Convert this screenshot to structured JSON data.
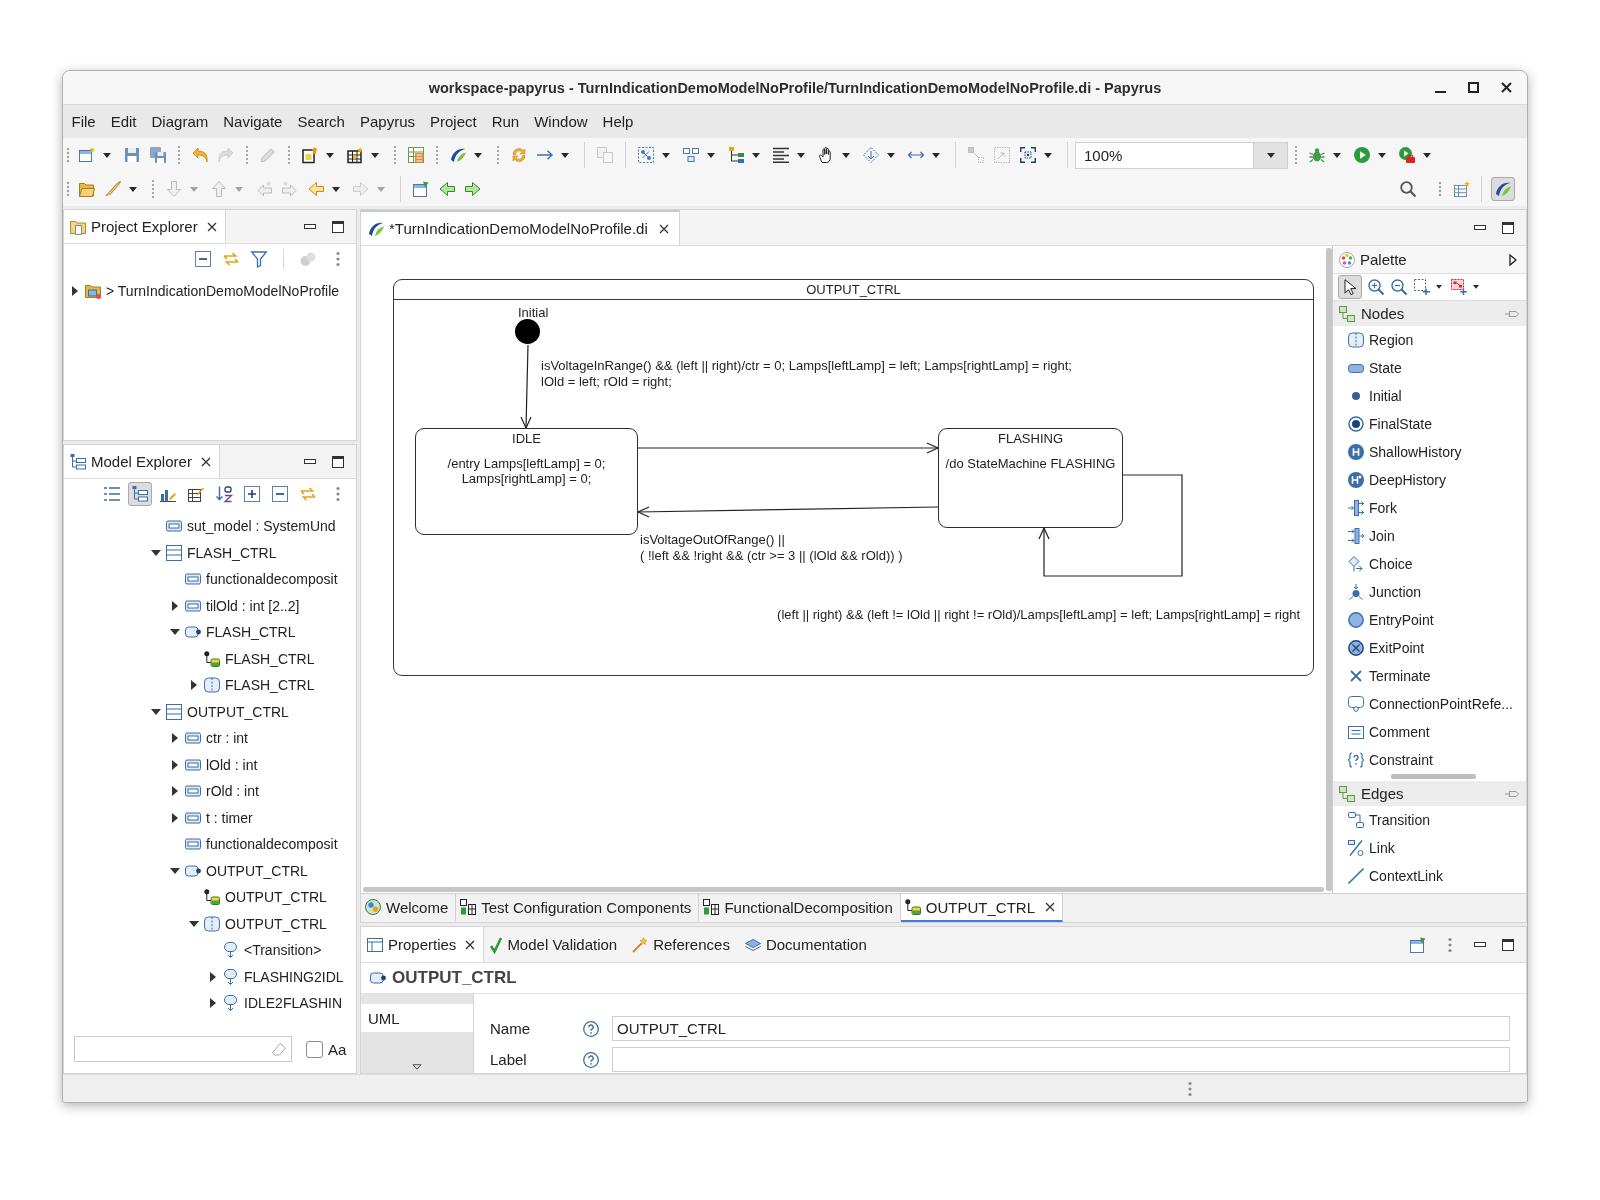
{
  "window": {
    "title": "workspace-papyrus - TurnIndicationDemoModelNoProfile/TurnIndicationDemoModelNoProfile.di - Papyrus"
  },
  "menu": [
    "File",
    "Edit",
    "Diagram",
    "Navigate",
    "Search",
    "Papyrus",
    "Project",
    "Run",
    "Window",
    "Help"
  ],
  "toolbar": {
    "row_1": [
      {
        "disabled": false
      },
      {
        "disabled": false
      },
      {
        "disabled": false
      },
      {
        "disabled": false
      },
      {
        "disabled": true
      },
      {
        "disabled": true
      },
      {
        "disabled": false
      },
      {
        "disabled": false
      },
      {
        "disabled": false
      },
      {
        "disabled": false
      },
      {
        "disabled": false
      },
      {
        "disabled": false
      },
      {
        "disabled": true
      },
      {
        "disabled": false
      },
      {
        "disabled": false
      },
      {
        "disabled": false
      },
      {
        "disabled": false
      },
      {
        "disabled": false
      },
      {
        "disabled": false
      },
      {
        "disabled": false
      },
      {
        "disabled": true
      },
      {
        "disabled": true
      },
      {
        "disabled": false
      },
      {
        "disabled": false
      },
      {
        "disabled": false
      },
      {
        "disabled": false
      }
    ],
    "zoom": "100%",
    "row_2": [
      {
        "disabled": false
      },
      {
        "disabled": false
      },
      {
        "disabled": true
      },
      {
        "disabled": true
      },
      {
        "disabled": true
      },
      {
        "disabled": true
      },
      {
        "disabled": false
      },
      {
        "disabled": true
      },
      {
        "disabled": false
      },
      {
        "disabled": false
      },
      {
        "disabled": false
      }
    ],
    "row_2_right": [
      {
        "disabled": false
      },
      {
        "disabled": false
      }
    ],
    "perspectives": [
      {
        "selected": true
      }
    ]
  },
  "project_explorer": {
    "title": "Project Explorer",
    "toolbar": [
      {
        "disabled": false
      },
      {
        "disabled": false
      },
      {
        "disabled": false
      },
      {
        "disabled": true
      }
    ],
    "tree": [
      {
        "label": "> TurnIndicationDemoModelNoProfile",
        "kind": "project",
        "expanded": false
      }
    ]
  },
  "model_explorer": {
    "title": "Model Explorer",
    "toolbar": [
      {
        "pressed": false
      },
      {
        "pressed": true
      },
      {
        "pressed": false
      },
      {
        "pressed": false
      },
      {
        "pressed": false
      },
      {
        "pressed": false
      },
      {
        "pressed": false
      },
      {
        "pressed": false
      }
    ],
    "tree": [
      {
        "label": "sut_model : SystemUnd",
        "kind": "attribute"
      },
      {
        "label": "FLASH_CTRL",
        "kind": "class",
        "expanded": true,
        "children": [
          {
            "label": "functionaldecomposit",
            "kind": "attribute"
          },
          {
            "label": "tilOld : int [2..2]",
            "kind": "attribute",
            "expanded": false
          },
          {
            "label": "FLASH_CTRL",
            "kind": "state-machine",
            "expanded": true,
            "children": [
              {
                "label": "FLASH_CTRL",
                "kind": "diagram"
              },
              {
                "label": "FLASH_CTRL",
                "kind": "region",
                "expanded": false
              }
            ]
          }
        ]
      },
      {
        "label": "OUTPUT_CTRL",
        "kind": "class",
        "expanded": true,
        "children": [
          {
            "label": "ctr : int",
            "kind": "attribute",
            "expanded": false
          },
          {
            "label": "lOld : int",
            "kind": "attribute",
            "expanded": false
          },
          {
            "label": "rOld : int",
            "kind": "attribute",
            "expanded": false
          },
          {
            "label": "t : timer",
            "kind": "attribute",
            "expanded": false
          },
          {
            "label": "functionaldecomposit",
            "kind": "attribute"
          },
          {
            "label": "OUTPUT_CTRL",
            "kind": "state-machine",
            "expanded": true,
            "children": [
              {
                "label": "OUTPUT_CTRL",
                "kind": "diagram"
              },
              {
                "label": "OUTPUT_CTRL",
                "kind": "region",
                "expanded": true,
                "children": [
                  {
                    "label": "<Transition>",
                    "kind": "transition"
                  },
                  {
                    "label": "FLASHING2IDL",
                    "kind": "transition",
                    "expanded": false
                  },
                  {
                    "label": "IDLE2FLASHIN",
                    "kind": "transition",
                    "expanded": false
                  }
                ]
              }
            ]
          }
        ]
      }
    ],
    "filter": {
      "case_sensitive": {
        "label": "Aa",
        "checked": false
      }
    }
  },
  "editor": {
    "tabs": [
      {
        "label": "*TurnIndicationDemoModelNoProfile.di",
        "selected": true
      }
    ],
    "diagram": {
      "frame_title": "OUTPUT_CTRL",
      "initial_label": "Initial",
      "states": [
        {
          "name": "IDLE",
          "behavior": [
            "/entry Lamps[leftLamp] = 0;",
            "Lamps[rightLamp] = 0;"
          ]
        },
        {
          "name": "FLASHING",
          "behavior": [
            "/do StateMachine FLASHING"
          ]
        }
      ],
      "transitions": [
        {
          "kind": "initial",
          "label": [
            "isVoltageInRange() && (left || right)/ctr = 0; Lamps[leftLamp] = left; Lamps[rightLamp] = right;",
            "lOld = left; rOld = right;"
          ]
        },
        {
          "kind": "forward"
        },
        {
          "kind": "backward",
          "label": [
            "isVoltageOutOfRange() ||",
            "( !left && !right && (ctr >= 3 || (lOld && rOld)) )"
          ]
        },
        {
          "kind": "self",
          "label": [
            "(left || right) && (left != lOld || right != rOld)/Lamps[leftLamp] = left; Lamps[rightLamp] = right"
          ]
        }
      ]
    },
    "pages": [
      {
        "label": "Welcome",
        "kind": "welcome",
        "selected": false
      },
      {
        "label": "Test Configuration Components",
        "kind": "table",
        "selected": false
      },
      {
        "label": "FunctionalDecomposition",
        "kind": "table",
        "selected": false
      },
      {
        "label": "OUTPUT_CTRL",
        "kind": "diagram",
        "selected": true
      }
    ]
  },
  "palette": {
    "title": "Palette",
    "tools": [
      {
        "pressed": true
      },
      {
        "pressed": false
      },
      {
        "pressed": false
      },
      {
        "pressed": false
      },
      {
        "pressed": false
      }
    ],
    "drawers": [
      {
        "label": "Nodes",
        "items": [
          {
            "label": "Region",
            "kind": "region"
          },
          {
            "label": "State",
            "kind": "state"
          },
          {
            "label": "Initial",
            "kind": "initial"
          },
          {
            "label": "FinalState",
            "kind": "final"
          },
          {
            "label": "ShallowHistory",
            "kind": "shallow-history"
          },
          {
            "label": "DeepHistory",
            "kind": "deep-history"
          },
          {
            "label": "Fork",
            "kind": "fork"
          },
          {
            "label": "Join",
            "kind": "join"
          },
          {
            "label": "Choice",
            "kind": "choice"
          },
          {
            "label": "Junction",
            "kind": "junction"
          },
          {
            "label": "EntryPoint",
            "kind": "entry-point"
          },
          {
            "label": "ExitPoint",
            "kind": "exit-point"
          },
          {
            "label": "Terminate",
            "kind": "terminate"
          },
          {
            "label": "ConnectionPointRefe...",
            "kind": "connection-point"
          },
          {
            "label": "Comment",
            "kind": "comment"
          },
          {
            "label": "Constraint",
            "kind": "constraint"
          }
        ]
      },
      {
        "label": "Edges",
        "items": [
          {
            "label": "Transition",
            "kind": "transition"
          },
          {
            "label": "Link",
            "kind": "link"
          },
          {
            "label": "ContextLink",
            "kind": "context-link"
          }
        ]
      }
    ]
  },
  "properties": {
    "tabs": [
      {
        "label": "Properties",
        "kind": "properties",
        "selected": true
      },
      {
        "label": "Model Validation",
        "kind": "validation",
        "selected": false
      },
      {
        "label": "References",
        "kind": "references",
        "selected": false
      },
      {
        "label": "Documentation",
        "kind": "documentation",
        "selected": false
      }
    ],
    "title": "OUTPUT_CTRL",
    "sections": [
      {
        "label": "UML",
        "selected": true
      }
    ],
    "fields": [
      {
        "label": "Name",
        "value": "OUTPUT_CTRL"
      },
      {
        "label": "Label"
      }
    ]
  }
}
